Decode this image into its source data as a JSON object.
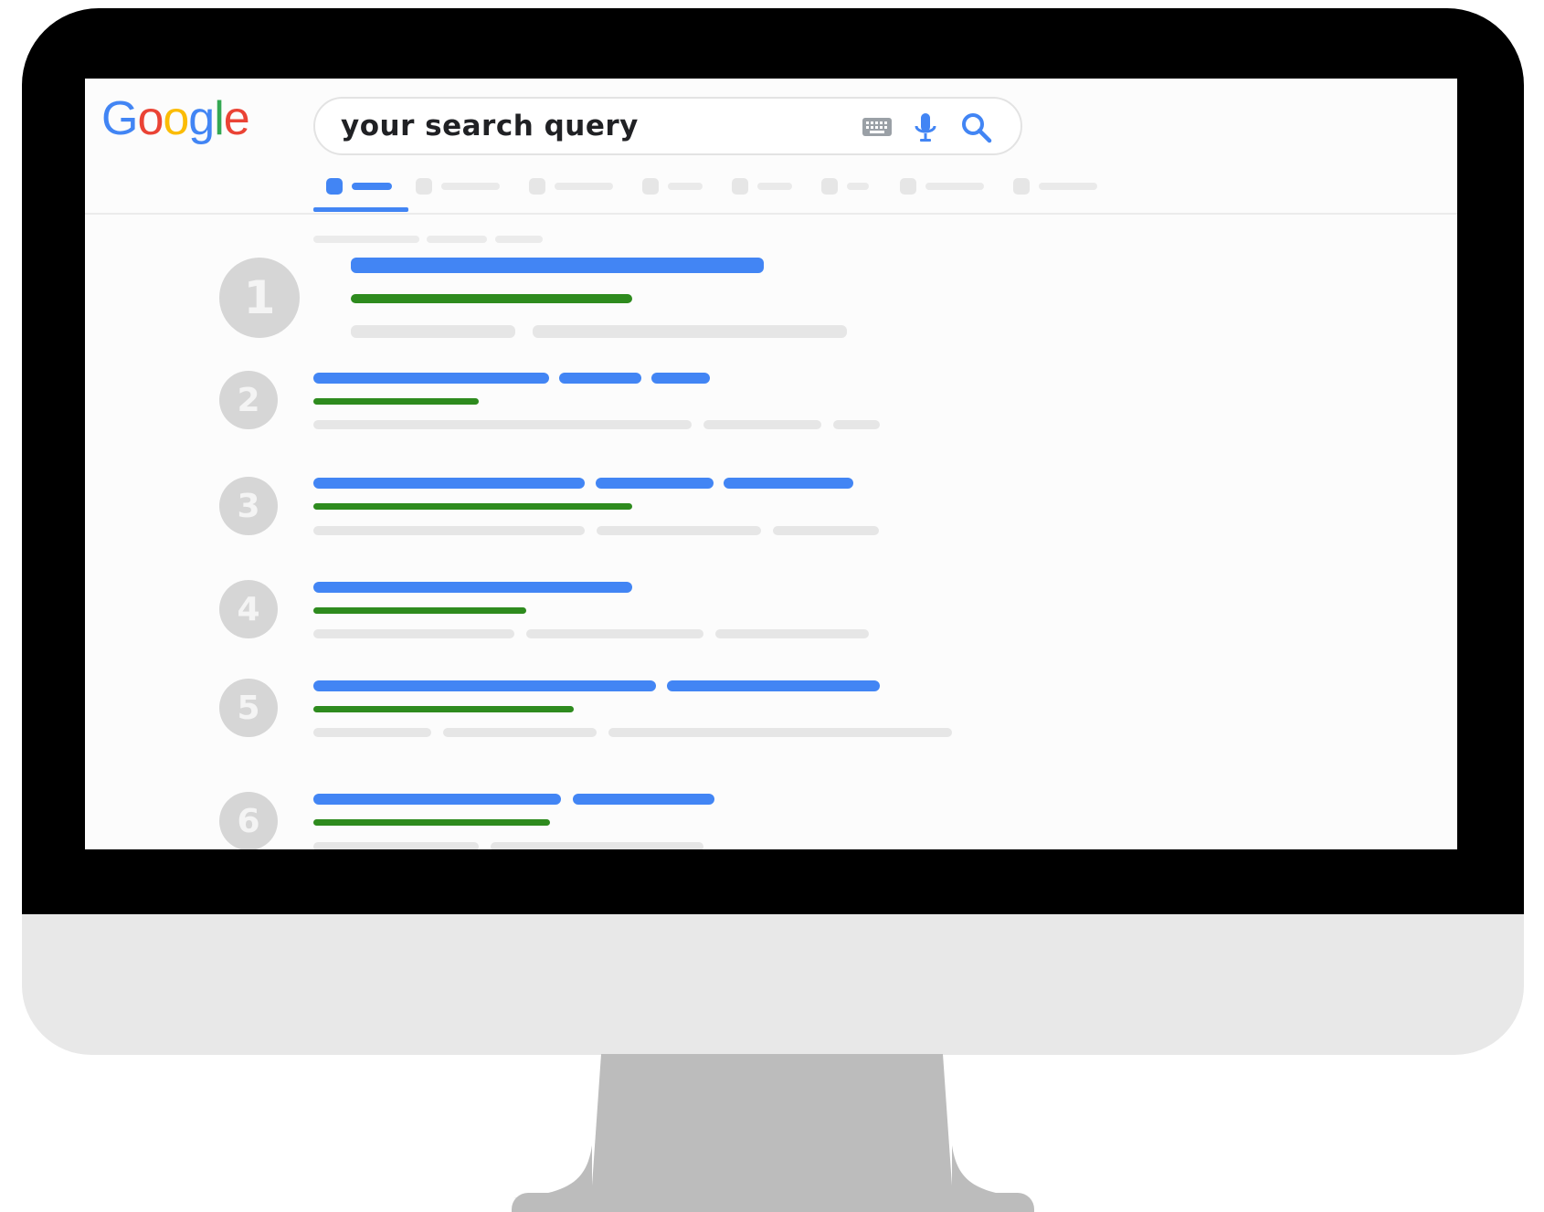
{
  "search": {
    "query": "your search query"
  },
  "logo": {
    "text": "Google",
    "letters": [
      {
        "ch": "G",
        "color": "#4285f4"
      },
      {
        "ch": "o",
        "color": "#ea4335"
      },
      {
        "ch": "o",
        "color": "#fbbc05"
      },
      {
        "ch": "g",
        "color": "#4285f4"
      },
      {
        "ch": "l",
        "color": "#34a853"
      },
      {
        "ch": "e",
        "color": "#ea4335"
      }
    ]
  },
  "icons": {
    "keyboard": "keyboard-icon",
    "mic": "microphone-icon",
    "search": "search-icon"
  },
  "tabs": {
    "count": 8,
    "active_index": 0
  },
  "results": [
    {
      "rank": "1"
    },
    {
      "rank": "2"
    },
    {
      "rank": "3"
    },
    {
      "rank": "4"
    },
    {
      "rank": "5"
    },
    {
      "rank": "6"
    }
  ],
  "colors": {
    "accent_blue": "#4285f4",
    "url_green": "#2e8b1e",
    "placeholder_gray": "#e6e6e6",
    "rank_circle": "#d6d6d6",
    "bezel": "#000000",
    "chin": "#e8e8e8",
    "stand": "#bcbcbc"
  }
}
